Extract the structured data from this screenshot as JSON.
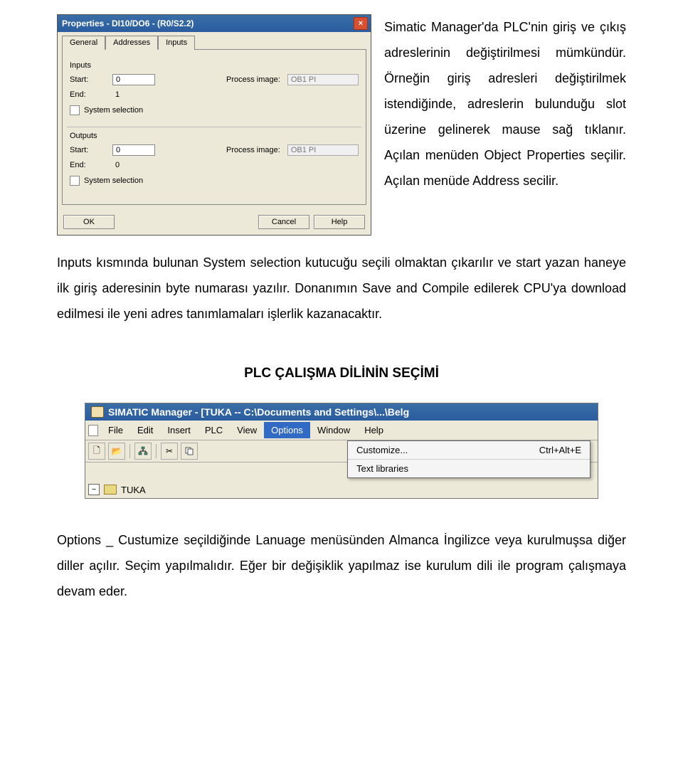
{
  "dialog": {
    "title": "Properties - DI10/DO6 - (R0/S2.2)",
    "tabs": [
      "General",
      "Addresses",
      "Inputs"
    ],
    "inputs": {
      "label": "Inputs",
      "start_label": "Start:",
      "start_value": "0",
      "pi_label": "Process image:",
      "pi_value": "OB1 PI",
      "end_label": "End:",
      "end_value": "1",
      "checkbox_label": "System selection"
    },
    "outputs": {
      "label": "Outputs",
      "start_label": "Start:",
      "start_value": "0",
      "pi_label": "Process image:",
      "pi_value": "OB1 PI",
      "end_label": "End:",
      "end_value": "0",
      "checkbox_label": "System selection"
    },
    "buttons": {
      "ok": "OK",
      "cancel": "Cancel",
      "help": "Help"
    }
  },
  "body": {
    "p1": "Simatic Manager'da PLC'nin giriş ve çıkış adreslerinin değiştirilmesi mümkündür. Örneğin giriş adresleri değiştirilmek istendiğinde, adreslerin bulunduğu slot üzerine gelinerek mause sağ tıklanır. Açılan menüden Object Properties seçilir. Açılan menüde Address secilir.",
    "p2": "Inputs kısmında bulunan System selection kutucuğu seçili olmaktan çıkarılır ve start yazan haneye ilk giriş aderesinin byte numarası yazılır. Donanımın Save and Compile edilerek CPU'ya download edilmesi ile yeni adres tanımlamaları işlerlik kazanacaktır.",
    "heading": "PLC ÇALIŞMA DİLİNİN SEÇİMİ",
    "p3": "Options _ Custumize seçildiğinde Lanuage menüsünden Almanca İngilizce veya kurulmuşsa diğer diller açılır. Seçim yapılmalıdır. Eğer bir değişiklik yapılmaz ise kurulum dili ile program çalışmaya devam eder."
  },
  "simatic": {
    "title": "SIMATIC Manager - [TUKA -- C:\\Documents and Settings\\...\\Belg",
    "menu": [
      "File",
      "Edit",
      "Insert",
      "PLC",
      "View",
      "Options",
      "Window",
      "Help"
    ],
    "toolbar_icons": [
      "new-icon",
      "open-icon",
      "tree-icon",
      "cut-icon",
      "copy-icon"
    ],
    "dropdown": [
      {
        "label": "Customize...",
        "shortcut": "Ctrl+Alt+E"
      },
      {
        "label": "Text libraries",
        "shortcut": ""
      }
    ],
    "tree_root": "TUKA"
  }
}
